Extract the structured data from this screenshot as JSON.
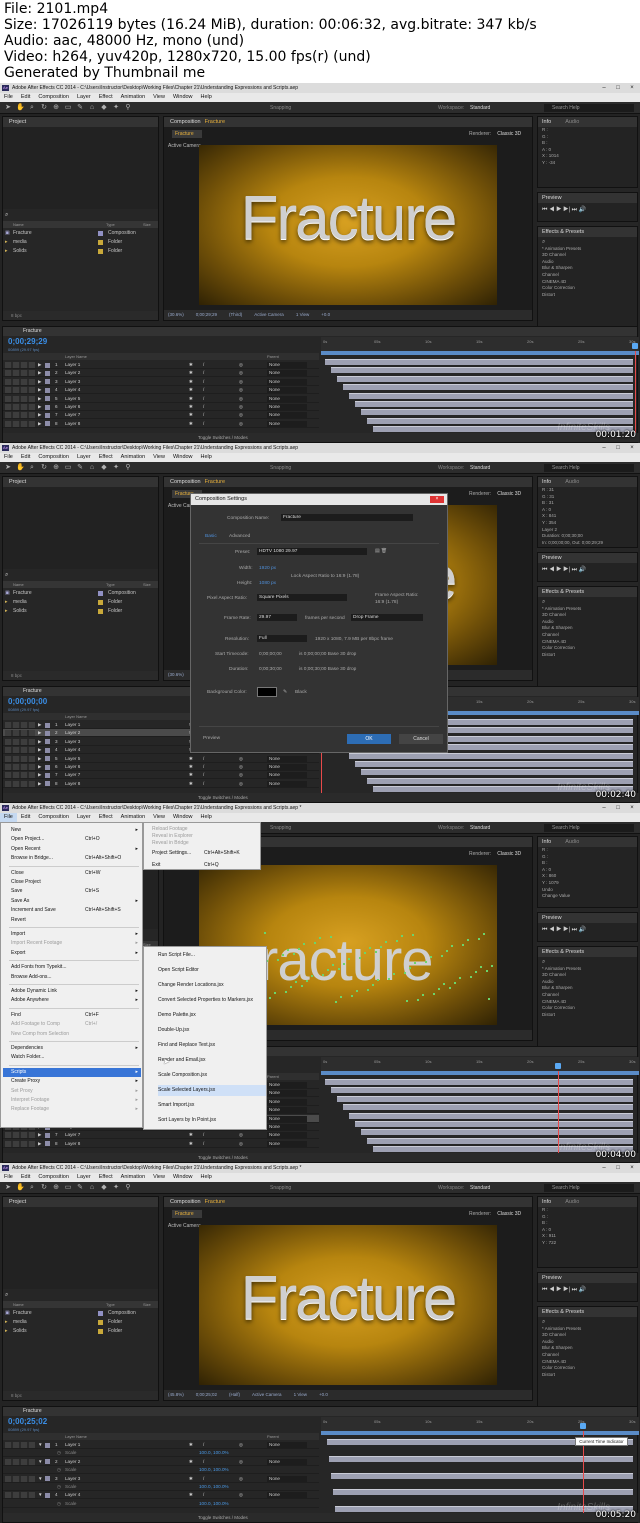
{
  "header": {
    "file": "File: 2101.mp4",
    "size": "Size: 17026119 bytes (16.24 MiB), duration: 00:06:32, avg.bitrate: 347 kb/s",
    "audio": "Audio: aac, 48000 Hz, mono (und)",
    "video": "Video: h264, yuv420p, 1280x720, 15.00 fps(r) (und)",
    "generated": "Generated by Thumbnail me"
  },
  "app": {
    "title": "Adobe After Effects CC 2014 - C:\\Users\\Instructor\\Desktop\\Working Files\\Chapter 21\\Understanding Expressions and Scripts.aep",
    "title_mod": "Adobe After Effects CC 2014 - C:\\Users\\Instructor\\Desktop\\Working Files\\Chapter 21\\Understanding Expressions and Scripts.aep *",
    "menu": [
      "File",
      "Edit",
      "Composition",
      "Layer",
      "Effect",
      "Animation",
      "View",
      "Window",
      "Help"
    ],
    "snapping": "Snapping",
    "workspace_label": "Workspace:",
    "workspace": "Standard",
    "search": "Search Help"
  },
  "project": {
    "title": "Project",
    "search_icon": "⌕",
    "cols": [
      "Name",
      "Type",
      "Size"
    ],
    "items": [
      {
        "name": "Fracture",
        "type": "Composition",
        "icon": "comp-icon"
      },
      {
        "name": "media",
        "type": "Folder",
        "icon": "folder-icon"
      },
      {
        "name": "Solids",
        "type": "Folder",
        "icon": "folder-icon"
      }
    ],
    "footer": "8 bpc"
  },
  "comp": {
    "panel": "Composition",
    "name": "Fracture",
    "renderer": "Renderer:",
    "renderer_val": "Classic 3D",
    "camera": "Active Camera",
    "text": "Fracture",
    "bar1": [
      "(30.6%)",
      "0;00;29;29",
      "(Third)",
      "Active Camera",
      "1 View",
      "+0.0"
    ],
    "bar3": [
      "(Half)",
      "Active Camera",
      "1 View",
      "+0.0"
    ],
    "bar4": [
      "(45.8%)",
      "0;00;25;02",
      "(Half)",
      "Active Camera",
      "1 View",
      "+0.0"
    ]
  },
  "right": {
    "info": "Info",
    "audio": "Audio",
    "info_lines1": [
      "R :",
      "G :",
      "B :",
      "A : 0",
      "X : 1014",
      "Y : -34"
    ],
    "info_lines2": [
      "R : 31",
      "G : 31",
      "B : 31",
      "A : 0",
      "X : 841",
      "Y : 354",
      "Layer 2",
      "Duration: 0;00;30;00",
      "In: 0;00;00;00, Out: 0;00;29;29"
    ],
    "info_lines3": [
      "R :",
      "G :",
      "B :",
      "A : 0",
      "X : 860",
      "Y : 1079",
      "Undo",
      "Change Value"
    ],
    "info_lines4": [
      "R :",
      "G :",
      "B :",
      "A : 0",
      "X : 911",
      "Y : 722"
    ],
    "preview": "Preview",
    "effects": "Effects & Presets",
    "effects_list": [
      "* Animation Presets",
      "3D Channel",
      "Audio",
      "Blur & Sharpen",
      "Channel",
      "CINEMA 4D",
      "Color Correction",
      "Distort"
    ]
  },
  "timeline": {
    "tab": "Fracture",
    "render_queue": "Render Queue",
    "time1": "0;00;29;29",
    "time2": "0;00;00;00",
    "time4": "0;00;25;02",
    "fps": "00899 (29.97 fps)",
    "cols": [
      "Layer Name",
      "Parent"
    ],
    "layers": [
      "Layer 1",
      "Layer 2",
      "Layer 3",
      "Layer 4",
      "Layer 5",
      "Layer 6",
      "Layer 7",
      "Layer 8"
    ],
    "parent": "None",
    "ticks": [
      "0s",
      "05s",
      "10s",
      "15s",
      "20s",
      "25s",
      "30s"
    ],
    "toggle": "Toggle Switches / Modes",
    "scale": "Scale",
    "scale_val": "100.0, 100.0%",
    "tooltip": "Current Time Indicator"
  },
  "stamps": [
    "00:01:20",
    "00:02:40",
    "00:04:00",
    "00:05:20"
  ],
  "watermark": "InfiniteSkills",
  "dialog": {
    "title": "Composition Settings",
    "name_label": "Composition Name:",
    "name": "Fracture",
    "tabs": [
      "Basic",
      "Advanced"
    ],
    "preset_label": "Preset:",
    "preset": "HDTV 1080 29.97",
    "width_label": "Width:",
    "width": "1920 px",
    "height_label": "Height:",
    "height": "1080 px",
    "lock": "Lock Aspect Ratio to 16:9 (1.78)",
    "par_label": "Pixel Aspect Ratio:",
    "par": "Square Pixels",
    "far_label": "Frame Aspect Ratio:",
    "far": "16:9 (1.78)",
    "fr_label": "Frame Rate:",
    "fr": "29.97",
    "fps_label": "frames per second",
    "drop": "Drop Frame",
    "res_label": "Resolution:",
    "res": "Full",
    "res_info": "1920 x 1080, 7.9 MB per 8bpc frame",
    "st_label": "Start Timecode:",
    "st": "0;00;00;00",
    "st_info": "is 0;00;00;00  Base 30  drop",
    "dur_label": "Duration:",
    "dur": "0;00;30;00",
    "dur_info": "is 0;00;30;00  Base 30  drop",
    "bg_label": "Background Color:",
    "bg": "Black",
    "preview": "Preview",
    "ok": "OK",
    "cancel": "Cancel"
  },
  "filemenu": {
    "items": [
      {
        "l": "New",
        "k": "",
        "ar": "▸",
        "d": false
      },
      {
        "l": "Open Project...",
        "k": "Ctrl+O",
        "ar": "",
        "d": false
      },
      {
        "l": "Open Recent",
        "k": "",
        "ar": "▸",
        "d": false
      },
      {
        "l": "Browse in Bridge...",
        "k": "Ctrl+Alt+Shift+O",
        "ar": "",
        "d": false
      },
      {
        "l": "Close",
        "k": "Ctrl+W",
        "ar": "",
        "d": false
      },
      {
        "l": "Close Project",
        "k": "",
        "ar": "",
        "d": false
      },
      {
        "l": "Save",
        "k": "Ctrl+S",
        "ar": "",
        "d": false
      },
      {
        "l": "Save As",
        "k": "",
        "ar": "▸",
        "d": false
      },
      {
        "l": "Increment and Save",
        "k": "Ctrl+Alt+Shift+S",
        "ar": "",
        "d": false
      },
      {
        "l": "Revert",
        "k": "",
        "ar": "",
        "d": false
      },
      {
        "l": "Import",
        "k": "",
        "ar": "▸",
        "d": false
      },
      {
        "l": "Import Recent Footage",
        "k": "",
        "ar": "▸",
        "d": true
      },
      {
        "l": "Export",
        "k": "",
        "ar": "▸",
        "d": false
      },
      {
        "l": "Add Fonts from Typekit...",
        "k": "",
        "ar": "",
        "d": false
      },
      {
        "l": "Browse Add-ons...",
        "k": "",
        "ar": "",
        "d": false
      },
      {
        "l": "Adobe Dynamic Link",
        "k": "",
        "ar": "▸",
        "d": false
      },
      {
        "l": "Adobe Anywhere",
        "k": "",
        "ar": "▸",
        "d": false
      },
      {
        "l": "Find",
        "k": "Ctrl+F",
        "ar": "",
        "d": false
      },
      {
        "l": "Add Footage to Comp",
        "k": "Ctrl+/",
        "ar": "",
        "d": true
      },
      {
        "l": "New Comp from Selection",
        "k": "",
        "ar": "",
        "d": true
      },
      {
        "l": "Dependencies",
        "k": "",
        "ar": "▸",
        "d": false
      },
      {
        "l": "Watch Folder...",
        "k": "",
        "ar": "",
        "d": false
      },
      {
        "l": "Scripts",
        "k": "",
        "ar": "▸",
        "d": false
      },
      {
        "l": "Create Proxy",
        "k": "",
        "ar": "▸",
        "d": false
      },
      {
        "l": "Set Proxy",
        "k": "",
        "ar": "▸",
        "d": true
      },
      {
        "l": "Interpret Footage",
        "k": "",
        "ar": "▸",
        "d": true
      },
      {
        "l": "Replace Footage",
        "k": "",
        "ar": "▸",
        "d": true
      }
    ],
    "col2": [
      {
        "l": "Reload Footage",
        "k": "",
        "d": true
      },
      {
        "l": "Reveal in Explorer",
        "k": "",
        "d": true
      },
      {
        "l": "Reveal in Bridge",
        "k": "",
        "d": true
      },
      {
        "l": "Project Settings...",
        "k": "Ctrl+Alt+Shift+K",
        "d": false
      },
      {
        "l": "Exit",
        "k": "Ctrl+Q",
        "d": false
      }
    ],
    "scripts": [
      "Run Script File...",
      "Open Script Editor",
      "Change Render Locations.jsx",
      "Convert Selected Properties to Markers.jsx",
      "Demo Palette.jsx",
      "Double-Up.jsx",
      "Find and Replace Text.jsx",
      "Render and Email.jsx",
      "Scale Composition.jsx",
      "Scale Selected Layers.jsx",
      "Smart Import.jsx",
      "Sort Layers by In Point.jsx"
    ]
  },
  "frag_text": "racture"
}
